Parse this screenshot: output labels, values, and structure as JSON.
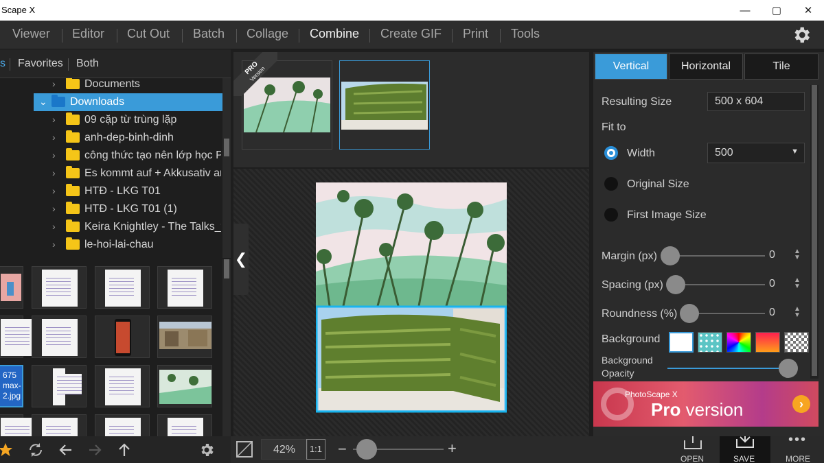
{
  "window": {
    "title": "Scape X"
  },
  "menu": {
    "items": [
      {
        "label": "Viewer"
      },
      {
        "label": "Editor"
      },
      {
        "label": "Cut Out"
      },
      {
        "label": "Batch"
      },
      {
        "label": "Collage"
      },
      {
        "label": "Combine",
        "active": true
      },
      {
        "label": "Create GIF"
      },
      {
        "label": "Print"
      },
      {
        "label": "Tools"
      }
    ]
  },
  "left": {
    "tabs": [
      "s",
      "Favorites",
      "Both"
    ],
    "tree": [
      {
        "label": "Documents"
      },
      {
        "label": "Downloads",
        "selected": true
      },
      {
        "label": "09 cặp từ trùng lặp"
      },
      {
        "label": "anh-dep-binh-dinh"
      },
      {
        "label": "công thức tạo nên lớp học PI"
      },
      {
        "label": "Es kommt auf + Akkusativ ar"
      },
      {
        "label": "HTĐ - LKG T01"
      },
      {
        "label": "HTĐ - LKG T01 (1)"
      },
      {
        "label": "Keira Knightley - The Talks_f"
      },
      {
        "label": "le-hoi-lai-chau"
      }
    ],
    "selected_file": {
      "line1": "675",
      "line2": "max-",
      "line3": "2.jpg"
    }
  },
  "center": {
    "zoom": "42%",
    "zoom_ratio": "1:1",
    "zoom_level": 0.1,
    "pro_label": "PRO",
    "pro_sub": "Version"
  },
  "right": {
    "tabs": [
      "Vertical",
      "Horizontal",
      "Tile"
    ],
    "active_tab": "Vertical",
    "resulting_size_label": "Resulting Size",
    "resulting_size": "500 x 604",
    "fit_to_label": "Fit to",
    "fit_options": [
      "Width",
      "Original Size",
      "First Image Size"
    ],
    "fit_selected": "Width",
    "width_value": "500",
    "margin_label": "Margin (px)",
    "margin_value": "0",
    "spacing_label": "Spacing (px)",
    "spacing_value": "0",
    "roundness_label": "Roundness (%)",
    "roundness_value": "0",
    "background_label": "Background",
    "opacity_label_1": "Background",
    "opacity_label_2": "Opacity",
    "background_opacity": 1.0
  },
  "promo": {
    "small": "PhotoScape X",
    "pro": "Pro",
    "version": " version"
  },
  "actions": {
    "open": "OPEN",
    "save": "SAVE",
    "more": "MORE"
  },
  "colors": {
    "accent": "#3a9bd9",
    "active_tab": "#3a9bd9",
    "folder": "#f5c518"
  }
}
